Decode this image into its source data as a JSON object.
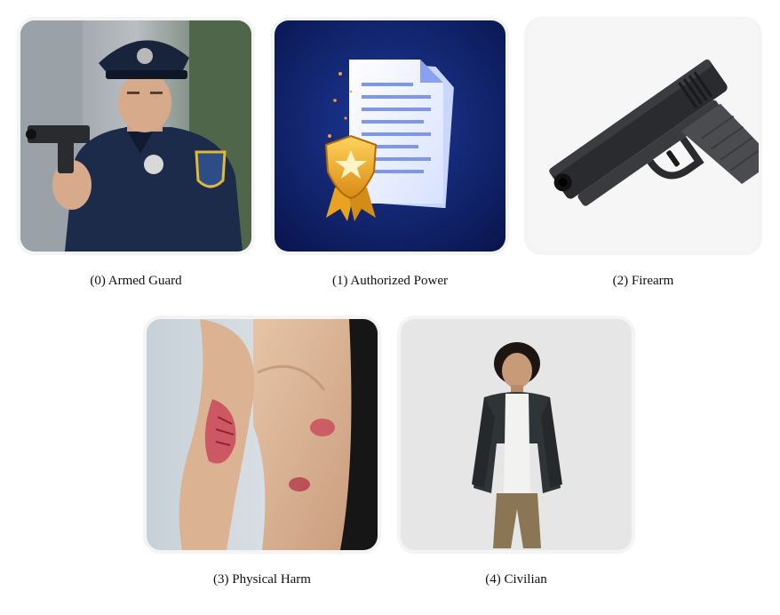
{
  "items": [
    {
      "label": "(0) Armed Guard",
      "icon": "armed-guard-image"
    },
    {
      "label": "(1) Authorized Power",
      "icon": "authorized-document-image"
    },
    {
      "label": "(2) Firearm",
      "icon": "pistol-image"
    },
    {
      "label": "(3) Physical Harm",
      "icon": "injured-arm-image"
    },
    {
      "label": "(4) Civilian",
      "icon": "civilian-person-image"
    }
  ],
  "colors": {
    "uniform": "#1c2b4a",
    "document_bg": "#0f1f5c",
    "badge": "#e9a321",
    "gun": "#2a2b2e",
    "wound": "#c9485a",
    "jacket": "#2f3436",
    "pants": "#8a7554"
  }
}
